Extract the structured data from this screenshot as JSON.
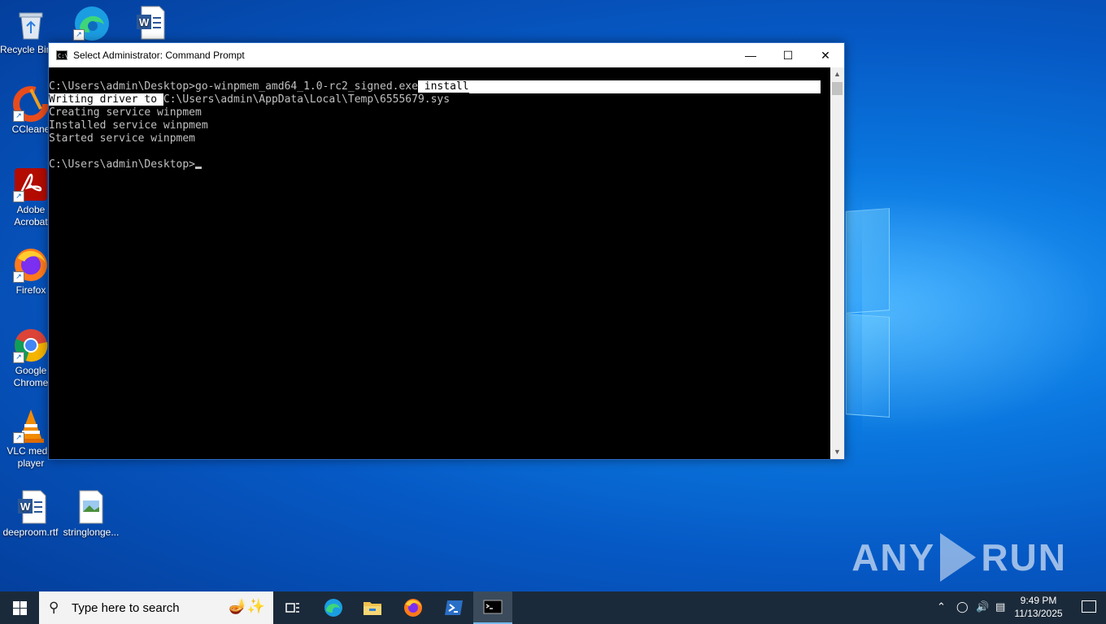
{
  "desktop": {
    "icons": [
      {
        "label": "Recycle Bin"
      },
      {
        "label": "Microsoft Edge"
      },
      {
        "label": "Word document"
      },
      {
        "label": "CCleaner"
      },
      {
        "label": "Adobe Acrobat"
      },
      {
        "label": "Firefox"
      },
      {
        "label": "Google Chrome"
      },
      {
        "label": "VLC media player"
      },
      {
        "label": "deeproom.rtf"
      },
      {
        "label": "stringlonge..."
      }
    ]
  },
  "window": {
    "title": "Select Administrator: Command Prompt",
    "icon": "cmd-icon",
    "controls": {
      "minimize": "—",
      "maximize": "☐",
      "close": "✕"
    },
    "console": {
      "line1_prompt": "C:\\Users\\admin\\Desktop>",
      "line1_cmd": "go-winpmem_amd64_1.0-rc2_signed.exe",
      "line1_sel": " install",
      "line2_sel": "Writing driver to ",
      "line2_rest": "C:\\Users\\admin\\AppData\\Local\\Temp\\6555679.sys",
      "line3": "Creating service winpmem",
      "line4": "Installed service winpmem",
      "line5": "Started service winpmem",
      "line7_prompt": "C:\\Users\\admin\\Desktop>"
    }
  },
  "watermark": {
    "text_left": "ANY",
    "text_right": "RUN"
  },
  "taskbar": {
    "search_placeholder": "Type here to search",
    "apps": [
      "task-view",
      "edge",
      "file-explorer",
      "firefox",
      "powershell",
      "command-prompt"
    ],
    "clock_time": "9:49 PM",
    "clock_date": "11/13/2025"
  },
  "colors": {
    "taskbar": "#1b2a3a",
    "console_bg": "#000000",
    "console_fg": "#c0c0c0"
  }
}
